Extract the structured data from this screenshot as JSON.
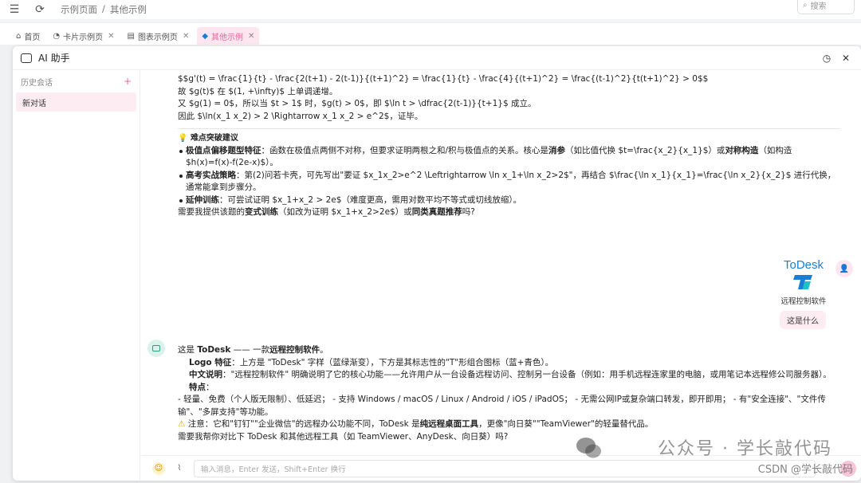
{
  "topbar": {
    "breadcrumb": [
      "示例页面",
      "/",
      "其他示例"
    ],
    "search_placeholder": "搜索"
  },
  "tabs": [
    {
      "label": "首页",
      "closable": false
    },
    {
      "label": "卡片示例页",
      "closable": true
    },
    {
      "label": "图表示例页",
      "closable": true
    },
    {
      "label": "其他示例",
      "closable": true,
      "active": true
    }
  ],
  "panel": {
    "title": "AI 助手"
  },
  "sidebar": {
    "history_label": "历史会话",
    "new_chat": "新对话"
  },
  "msg1": {
    "l1": "$$g'(t) = \\frac{1}{t} - \\frac{2(t+1) - 2(t-1)}{(t+1)^2} = \\frac{1}{t} - \\frac{4}{(t+1)^2} = \\frac{(t-1)^2}{t(t+1)^2} > 0$$",
    "l2": "故 $g(t)$ 在 $(1, +\\infty)$ 上单调递增。",
    "l3": "又 $g(1) = 0$，所以当 $t > 1$ 时，$g(t) > 0$，即 $\\ln t > \\dfrac{2(t-1)}{t+1}$ 成立。",
    "l4": "因此 $\\ln(x_1 x_2) > 2 \\Rightarrow x_1 x_2 > e^2$，证毕。",
    "tip_title": "难点突破建议",
    "b1_strong": "极值点偏移题型特征",
    "b1_text": "：函数在极值点两侧不对称，但要求证明两根之和/积与极值点的关系。核心是",
    "b1_s2": "消参",
    "b1_text2": "（如比值代换 $t=\\frac{x_2}{x_1}$）或",
    "b1_s3": "对称构造",
    "b1_text3": "（如构造 $h(x)=f(x)-f(2e-x)$）。",
    "b2_strong": "高考实战策略",
    "b2_text": "：第(2)问若卡壳，可先写出\"要证 $x_1x_2>e^2 \\Leftrightarrow \\ln x_1+\\ln x_2>2$\"，再结合 $\\frac{\\ln x_1}{x_1}=\\frac{\\ln x_2}{x_2}$ 进行代换，通常能拿到步骤分。",
    "b3_strong": "延伸训练",
    "b3_text": "：可尝试证明 $x_1+x_2 > 2e$（难度更高，需用对数平均不等式或切线放缩）。",
    "q_pre": "需要我提供该题的",
    "q_s1": "变式训练",
    "q_mid": "（如改为证明 $x_1+x_2>2e$）或",
    "q_s2": "同类真题推荐",
    "q_post": "吗?"
  },
  "user": {
    "logo_text": "ToDesk",
    "logo_caption": "远程控制软件",
    "question": "这是什么"
  },
  "msg2": {
    "intro_pre": "这是 ",
    "intro_b1": "ToDesk",
    "intro_mid": " —— 一款",
    "intro_b2": "远程控制软件",
    "intro_post": "。",
    "logo_label": "Logo 特征",
    "logo_text": "：上方是 \"ToDesk\" 字样（蓝绿渐变），下方是其标志性的\"T\"形组合图标（蓝+青色）。",
    "cn_label": "中文说明",
    "cn_text": "：\"远程控制软件\" 明确说明了它的核心功能——允许用户从一台设备远程访问、控制另一台设备（例如：用手机远程连家里的电脑，或用笔记本远程修公司服务器）。",
    "feat_label": "特点",
    "feat_text": "- 轻量、免费（个人版无限制）、低延迟； - 支持 Windows / macOS / Linux / Android / iOS / iPadOS； - 无需公网IP或复杂端口转发，即开即用； - 有\"安全连接\"、\"文件传输\"、\"多屏支持\"等功能。",
    "note_pre": "注意：它和\"钉钉\"\"企业微信\"的远程办公功能不同，ToDesk 是",
    "note_b": "纯远程桌面工具",
    "note_post": "，更像\"向日葵\"\"TeamViewer\"的轻量替代品。",
    "ask": "需要我帮你对比下 ToDesk 和其他远程工具（如 TeamViewer、AnyDesk、向日葵）吗?"
  },
  "input": {
    "placeholder": "输入消息，Enter 发送，Shift+Enter 换行"
  },
  "watermark": {
    "main": "公众号 · 学长敲代码",
    "csdn": "CSDN @学长敲代码"
  },
  "colors": {
    "accent": "#e06a9a",
    "todesk_blue": "#1a7fd4"
  }
}
